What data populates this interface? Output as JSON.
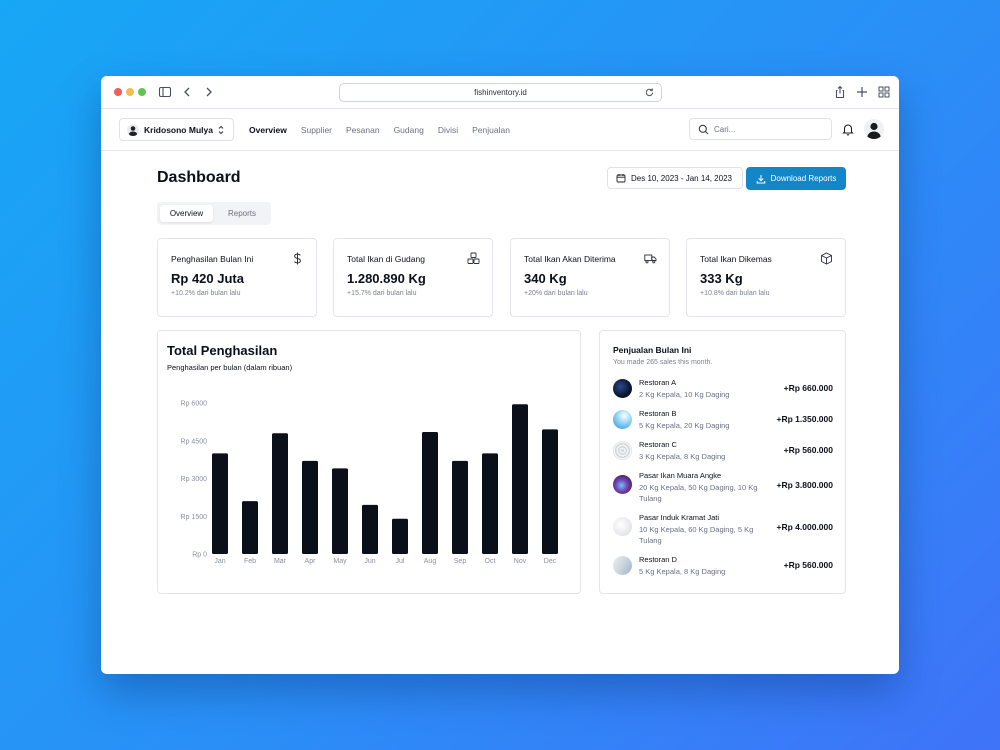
{
  "browser": {
    "url": "fishinventory.id"
  },
  "nav": {
    "account_name": "Kridosono Mulya",
    "links": [
      "Overview",
      "Supplier",
      "Pesanan",
      "Gudang",
      "Divisi",
      "Penjualan"
    ],
    "active_link": "Overview",
    "search_placeholder": "Cari..."
  },
  "header": {
    "title": "Dashboard",
    "date_range": "Des 10, 2023 - Jan 14, 2023",
    "download_label": "Download Reports"
  },
  "tabs": [
    "Overview",
    "Reports"
  ],
  "stats": [
    {
      "label": "Penghasilan Bulan Ini",
      "value": "Rp 420 Juta",
      "delta": "+10.2% dari bulan lalu",
      "icon": "dollar-icon"
    },
    {
      "label": "Total Ikan di Gudang",
      "value": "1.280.890 Kg",
      "delta": "+15.7% dari bulan lalu",
      "icon": "boxes-icon"
    },
    {
      "label": "Total Ikan Akan Diterima",
      "value": "340 Kg",
      "delta": "+20% dari bulan lalu",
      "icon": "truck-icon"
    },
    {
      "label": "Total Ikan Dikemas",
      "value": "333 Kg",
      "delta": "+10.8% dari bulan lalu",
      "icon": "package-icon"
    }
  ],
  "chart_card": {
    "title": "Total Penghasilan",
    "subtitle": "Penghasilan per bulan (dalam ribuan)"
  },
  "chart_data": {
    "type": "bar",
    "categories": [
      "Jan",
      "Feb",
      "Mar",
      "Apr",
      "May",
      "Jun",
      "Jul",
      "Aug",
      "Sep",
      "Oct",
      "Nov",
      "Dec"
    ],
    "values": [
      4000,
      2100,
      4800,
      3700,
      3400,
      1950,
      1400,
      4850,
      3700,
      4000,
      5950,
      4950
    ],
    "yticks": [
      "Rp 0",
      "Rp 1500",
      "Rp 3000",
      "Rp 4500",
      "Rp 6000"
    ],
    "ylim": [
      0,
      6000
    ],
    "bar_color": "#0b0f1a"
  },
  "sales": {
    "title": "Penjualan Bulan Ini",
    "subtitle": "You made 265 sales this month.",
    "items": [
      {
        "name": "Restoran A",
        "detail": "2 Kg Kepala, 10 Kg Daging",
        "amount": "+Rp 660.000"
      },
      {
        "name": "Restoran B",
        "detail": "5 Kg Kepala, 20 Kg Daging",
        "amount": "+Rp 1.350.000"
      },
      {
        "name": "Restoran C",
        "detail": "3 Kg Kepala, 8 Kg Daging",
        "amount": "+Rp 560.000"
      },
      {
        "name": "Pasar Ikan Muara Angke",
        "detail": "20 Kg Kepala, 50 Kg Daging, 10 Kg Tulang",
        "amount": "+Rp 3.800.000"
      },
      {
        "name": "Pasar Induk Kramat Jati",
        "detail": "10 Kg Kepala, 60 Kg Daging, 5 Kg Tulang",
        "amount": "+Rp 4.000.000"
      },
      {
        "name": "Restoran D",
        "detail": "5 Kg Kepala, 8 Kg Daging",
        "amount": "+Rp 560.000"
      }
    ]
  },
  "colors": {
    "accent": "#1386c8",
    "background_start": "#17a7f5",
    "background_end": "#3f73f8"
  }
}
